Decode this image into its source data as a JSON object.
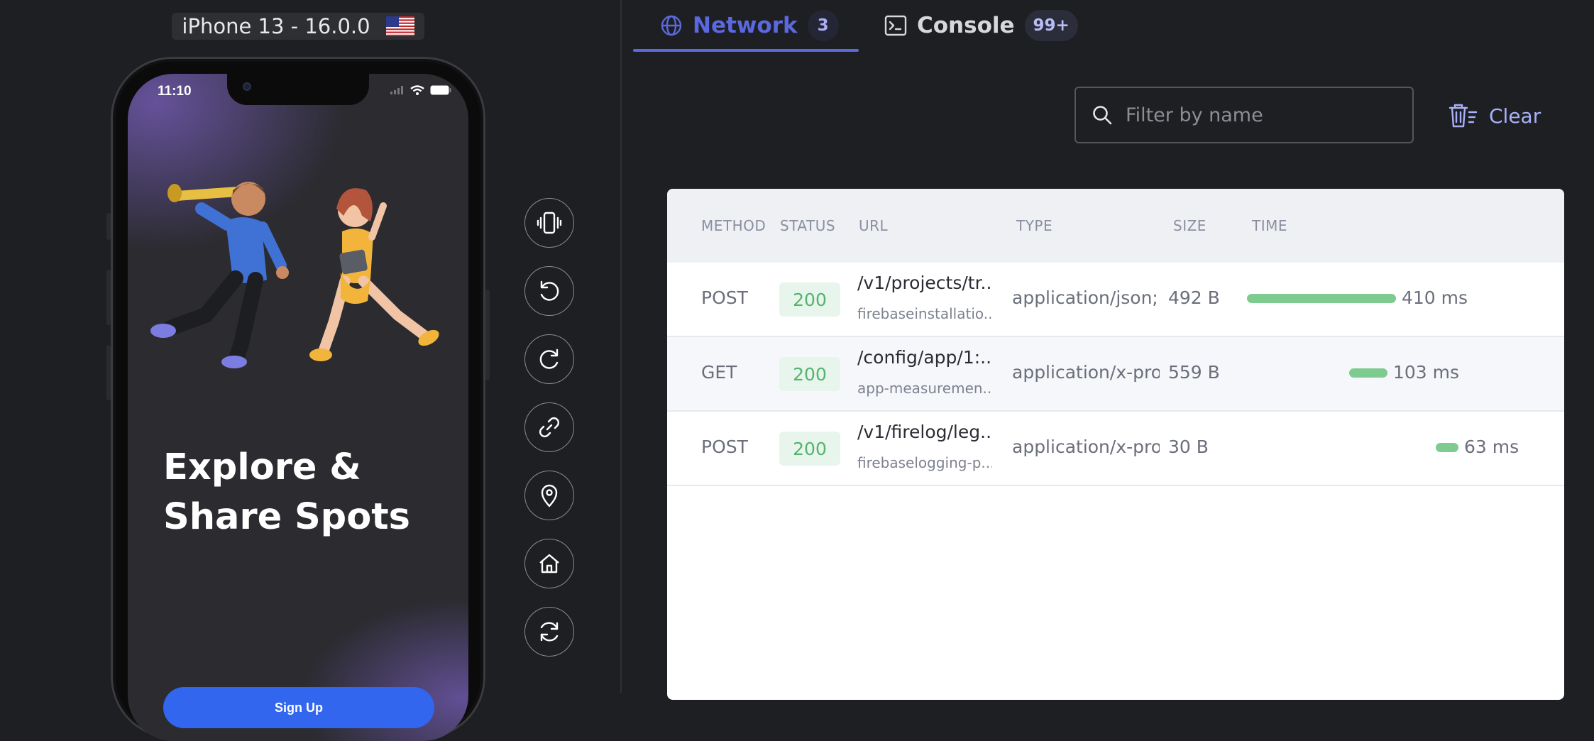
{
  "device": {
    "label": "iPhone 13 - 16.0.0",
    "flag_icon": "us-flag-icon"
  },
  "phone_screen": {
    "status_time": "11:10",
    "hero_title_line1": "Explore &",
    "hero_title_line2": "Share Spots",
    "signup_label": "Sign Up"
  },
  "tools": [
    {
      "icon": "vibrate-icon"
    },
    {
      "icon": "rotate-left-icon"
    },
    {
      "icon": "rotate-right-icon"
    },
    {
      "icon": "link-icon"
    },
    {
      "icon": "location-pin-icon"
    },
    {
      "icon": "home-icon"
    },
    {
      "icon": "reload-icon"
    }
  ],
  "tabs": [
    {
      "label": "Network",
      "badge": "3",
      "active": true
    },
    {
      "label": "Console",
      "badge": "99+",
      "active": false
    }
  ],
  "filter": {
    "placeholder": "Filter by name"
  },
  "clear_label": "Clear",
  "table": {
    "headers": {
      "method": "METHOD",
      "status": "STATUS",
      "url": "URL",
      "type": "TYPE",
      "size": "SIZE",
      "time": "TIME"
    },
    "rows": [
      {
        "method": "POST",
        "status": "200",
        "url": "/v1/projects/tr...",
        "host": "firebaseinstallatio...",
        "type": "application/json; c",
        "size": "492 B",
        "time": "410 ms"
      },
      {
        "method": "GET",
        "status": "200",
        "url": "/config/app/1:...",
        "host": "app-measuremen...",
        "type": "application/x-prot",
        "size": "559 B",
        "time": "103 ms"
      },
      {
        "method": "POST",
        "status": "200",
        "url": "/v1/firelog/leg...",
        "host": "firebaselogging-p...",
        "type": "application/x-prot",
        "size": "30 B",
        "time": "63 ms"
      }
    ]
  },
  "colors": {
    "accent": "#5b68df",
    "status_ok": "#54b46e",
    "timing_bar": "#7ecb8f",
    "signup_button": "#3266ee"
  }
}
